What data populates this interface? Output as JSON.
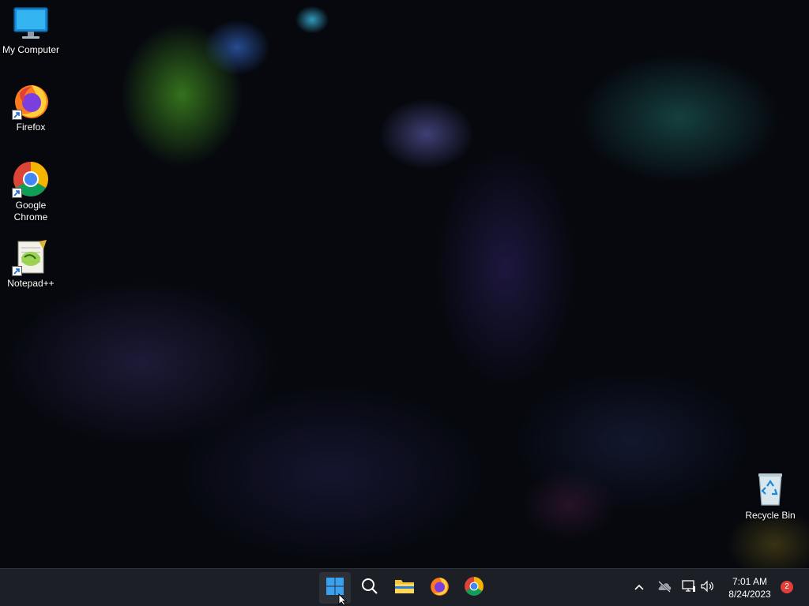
{
  "desktop": {
    "icons": [
      {
        "label": "My Computer",
        "icon": "monitor-icon"
      },
      {
        "label": "Firefox",
        "icon": "firefox-icon"
      },
      {
        "label": "Google Chrome",
        "icon": "chrome-icon"
      },
      {
        "label": "Notepad++",
        "icon": "notepadpp-icon"
      },
      {
        "label": "Recycle Bin",
        "icon": "recycle-bin-icon"
      }
    ]
  },
  "taskbar": {
    "pinned": [
      {
        "name": "start",
        "icon": "windows-start-icon",
        "active": true
      },
      {
        "name": "search",
        "icon": "search-icon"
      },
      {
        "name": "file-explorer",
        "icon": "folder-icon"
      },
      {
        "name": "firefox",
        "icon": "firefox-icon"
      },
      {
        "name": "chrome",
        "icon": "chrome-icon"
      }
    ],
    "tray": {
      "icons": [
        "chevron-up-icon",
        "onedrive-offline-icon",
        "network-icon",
        "speaker-icon"
      ],
      "time": "7:01 AM",
      "date": "8/24/2023",
      "notification_count": "2"
    }
  },
  "colors": {
    "taskbar_bg": "#1c1f26",
    "start_blue": "#3aa0f0",
    "badge_red": "#e0403a"
  }
}
